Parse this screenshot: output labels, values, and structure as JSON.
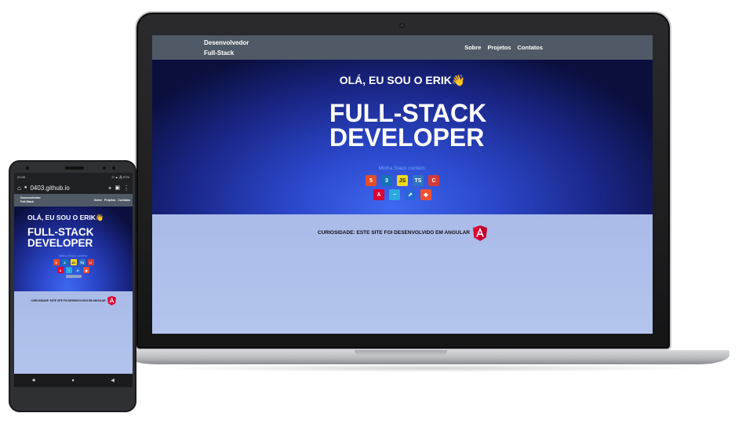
{
  "site": {
    "brand_line1": "Desenvolvedor",
    "brand_line2": "Full-Stack",
    "nav": [
      "Sobre",
      "Projetos",
      "Contatos"
    ],
    "hello": "OLÁ, EU SOU O ERIK",
    "hello_emoji": "👋",
    "title_line1": "FULL-STACK",
    "title_line2": "DEVELOPER",
    "stack_label": "Minha Stack contém:",
    "tech_row1": [
      {
        "label": "5",
        "icon": "html5-icon",
        "color": "#e44d26"
      },
      {
        "label": "3",
        "icon": "css3-icon",
        "color": "#1572b6"
      },
      {
        "label": "JS",
        "icon": "javascript-icon",
        "color": "#f0d91c"
      },
      {
        "label": "TS",
        "icon": "typescript-icon",
        "color": "#2f74c0"
      },
      {
        "label": "C",
        "icon": "csharp-icon",
        "color": "#d43a3a"
      }
    ],
    "tech_row2": [
      {
        "label": "A",
        "icon": "angular-icon",
        "color": "#dd0031"
      },
      {
        "label": "~",
        "icon": "tailwind-icon",
        "color": "#2aa8e0"
      },
      {
        "label": "⇗",
        "icon": "jira-icon",
        "color": "#2468d6"
      },
      {
        "label": "◆",
        "icon": "git-icon",
        "color": "#f05133"
      }
    ],
    "curiosity": "CURIOSIDADE: ESTE SITE FOI DESENVOLVIDO EM ANGULAR"
  },
  "phone": {
    "time": "21:09",
    "status_right": "⊙ ▲ ⁂ 97%",
    "url": "0403.github.io",
    "nav_bottom": [
      "■",
      "●",
      "◀"
    ]
  },
  "colors": {
    "nav": "#505a66",
    "hero_dark": "#0b0f3e",
    "hero_light": "#3f67f0",
    "body_bg": "#b3c4ee",
    "stack_label": "#6fa3ff"
  }
}
